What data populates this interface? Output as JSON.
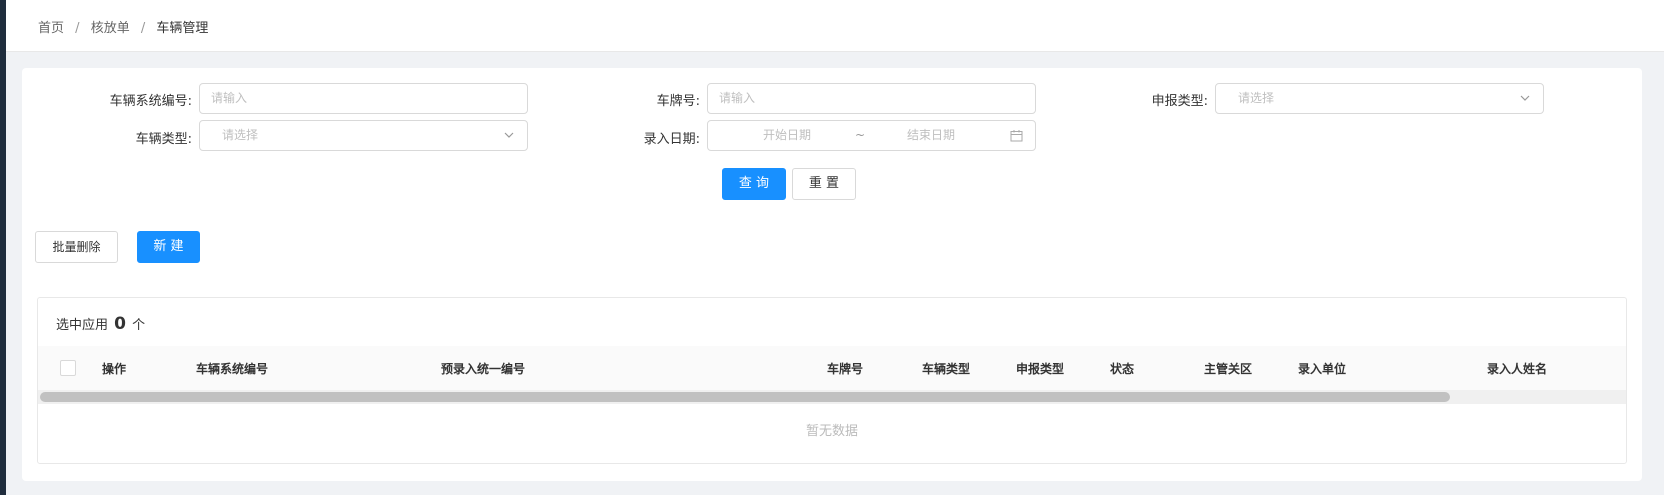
{
  "breadcrumb": [
    "首页",
    "核放单",
    "车辆管理"
  ],
  "search_form": {
    "vehicle_sys_no": {
      "label": "车辆系统编号:",
      "placeholder": "请输入"
    },
    "plate_no": {
      "label": "车牌号:",
      "placeholder": "请输入"
    },
    "declare_type": {
      "label": "申报类型:",
      "placeholder": "请选择"
    },
    "vehicle_type": {
      "label": "车辆类型:",
      "placeholder": "请选择"
    },
    "entry_date": {
      "label": "录入日期:",
      "start_placeholder": "开始日期",
      "separator": "~",
      "end_placeholder": "结束日期"
    },
    "query_label": "查 询",
    "reset_label": "重 置"
  },
  "toolbar": {
    "batch_delete_label": "批量删除",
    "new_label": "新 建"
  },
  "table": {
    "selected_prefix": "选中应用",
    "selected_count": "0",
    "selected_suffix": "个",
    "columns": [
      "操作",
      "车辆系统编号",
      "预录入统一编号",
      "车牌号",
      "车辆类型",
      "申报类型",
      "状态",
      "主管关区",
      "录入单位",
      "录入人姓名"
    ],
    "empty_text": "暂无数据",
    "scroll_position": 0.0,
    "scroll_visible_fraction": 0.89
  },
  "colors": {
    "primary": "#1890ff",
    "page_bg": "#f0f2f5",
    "sidebar": "#1f2d3d"
  },
  "icons": [
    "chevron-down-icon",
    "calendar-icon"
  ]
}
